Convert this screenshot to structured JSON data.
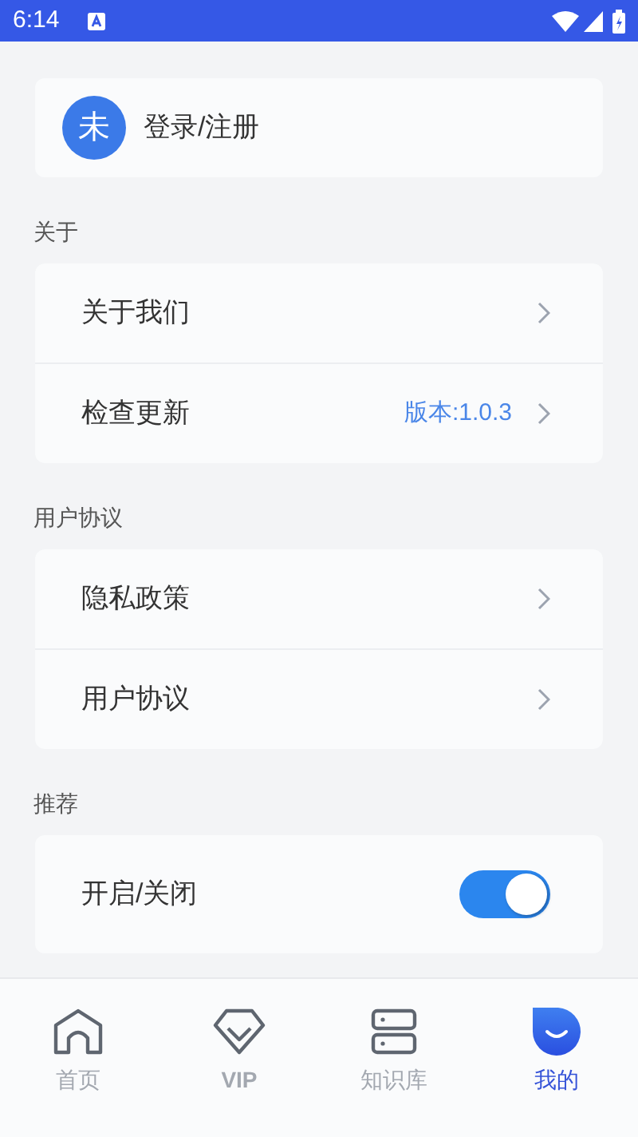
{
  "status_bar": {
    "time": "6:14"
  },
  "account": {
    "avatar": "未",
    "label": "登录/注册"
  },
  "sections": [
    {
      "title": "关于",
      "rows": [
        {
          "kind": "link",
          "label": "关于我们"
        },
        {
          "kind": "link",
          "label": "检查更新",
          "value": "版本:1.0.3"
        }
      ]
    },
    {
      "title": "用户协议",
      "rows": [
        {
          "kind": "link",
          "label": "隐私政策"
        },
        {
          "kind": "link",
          "label": "用户协议"
        }
      ]
    },
    {
      "title": "推荐",
      "rows": [
        {
          "kind": "toggle",
          "label": "开启/关闭",
          "on": true
        }
      ]
    }
  ],
  "tabs": [
    {
      "label": "首页",
      "kind": "home",
      "selected": false
    },
    {
      "label": "VIP",
      "kind": "vip",
      "selected": false
    },
    {
      "label": "知识库",
      "kind": "server",
      "selected": false
    },
    {
      "label": "我的",
      "kind": "me",
      "selected": true
    }
  ]
}
